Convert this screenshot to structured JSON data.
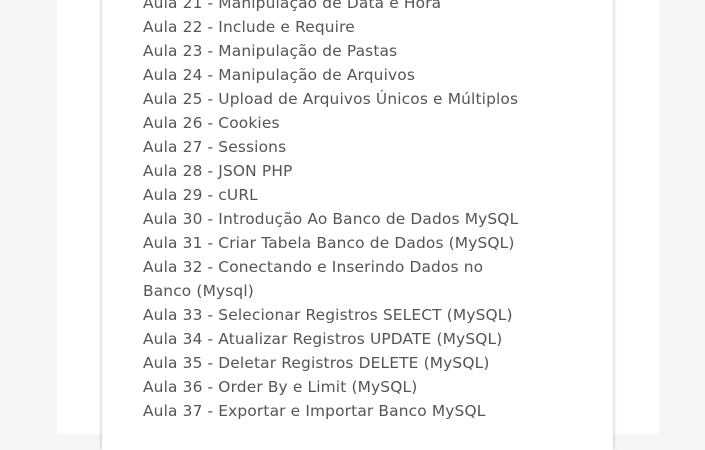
{
  "lessons": [
    {
      "label": "Aula 21 - Manipulação de Data e Hora"
    },
    {
      "label": "Aula 22 - Include e Require"
    },
    {
      "label": "Aula 23 - Manipulação de Pastas"
    },
    {
      "label": "Aula 24 - Manipulação de Arquivos"
    },
    {
      "label": "Aula 25 - Upload de Arquivos Únicos e Múltiplos"
    },
    {
      "label": "Aula 26 - Cookies"
    },
    {
      "label": "Aula 27 - Sessions"
    },
    {
      "label": "Aula 28 - JSON PHP"
    },
    {
      "label": "Aula 29 - cURL"
    },
    {
      "label": "Aula 30 - Introdução Ao Banco de Dados MySQL"
    },
    {
      "label": "Aula 31 - Criar Tabela Banco de Dados (MySQL)"
    },
    {
      "label": "Aula 32 - Conectando e Inserindo Dados no Banco (Mysql)"
    },
    {
      "label": "Aula 33 - Selecionar Registros SELECT (MySQL)"
    },
    {
      "label": "Aula 34 - Atualizar Registros UPDATE (MySQL)"
    },
    {
      "label": "Aula 35 - Deletar Registros DELETE (MySQL)"
    },
    {
      "label": "Aula 36 - Order By e Limit (MySQL)"
    },
    {
      "label": "Aula 37 - Exportar e Importar Banco MySQL"
    }
  ]
}
